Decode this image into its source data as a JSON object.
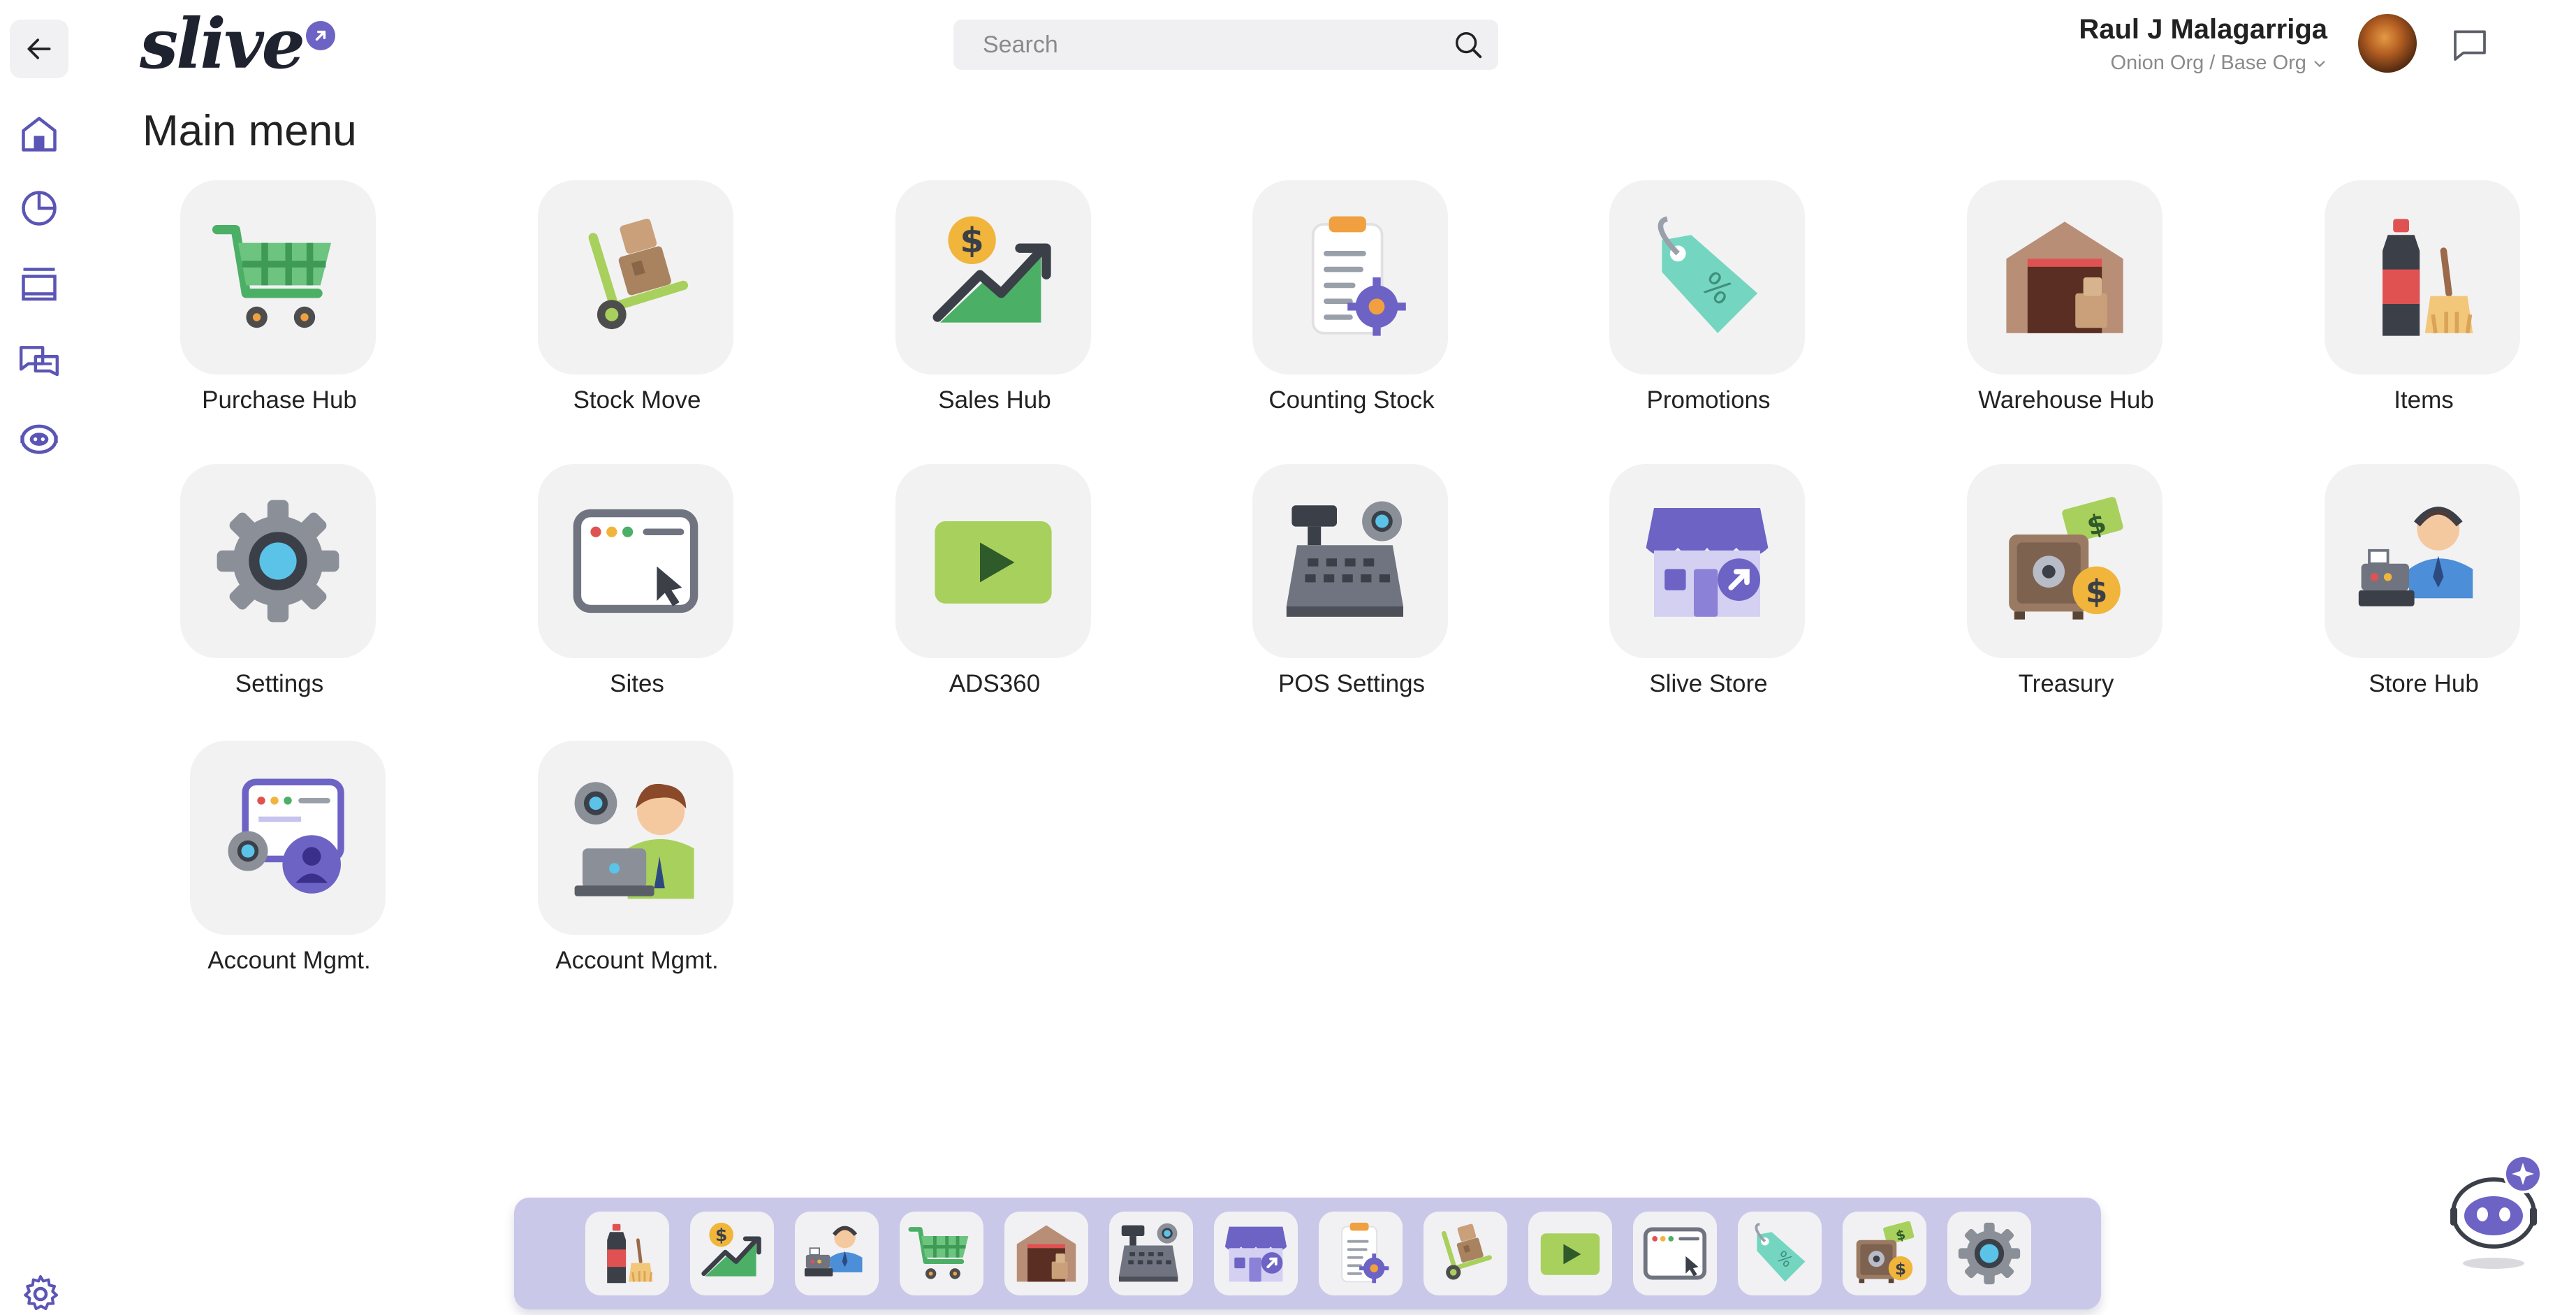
{
  "header": {
    "logo_text": "slive",
    "search_placeholder": "Search",
    "user_name": "Raul J Malagarriga",
    "org_path": "Onion Org /  Base Org"
  },
  "sidebar": {
    "items": [
      {
        "name": "back",
        "icon": "arrow-left-icon"
      },
      {
        "name": "home",
        "icon": "home-icon"
      },
      {
        "name": "analytics",
        "icon": "pie-chart-icon"
      },
      {
        "name": "windows",
        "icon": "window-stack-icon"
      },
      {
        "name": "messages",
        "icon": "chat-bubbles-icon"
      },
      {
        "name": "assistant",
        "icon": "robot-icon"
      }
    ],
    "bottom_icon": "gear-icon"
  },
  "main": {
    "title": "Main menu",
    "tiles": [
      {
        "label": "Purchase Hub",
        "icon": "shopping-cart-icon"
      },
      {
        "label": "Stock Move",
        "icon": "hand-truck-icon"
      },
      {
        "label": "Sales Hub",
        "icon": "sales-growth-icon"
      },
      {
        "label": "Counting Stock",
        "icon": "clipboard-gear-icon"
      },
      {
        "label": "Promotions",
        "icon": "discount-tag-icon"
      },
      {
        "label": "Warehouse Hub",
        "icon": "warehouse-icon"
      },
      {
        "label": "Items",
        "icon": "bottle-broom-icon"
      },
      {
        "label": "Settings",
        "icon": "settings-gear-icon"
      },
      {
        "label": "Sites",
        "icon": "browser-window-icon"
      },
      {
        "label": "ADS360",
        "icon": "play-video-icon"
      },
      {
        "label": "POS Settings",
        "icon": "cash-register-gear-icon"
      },
      {
        "label": "Slive Store",
        "icon": "storefront-icon"
      },
      {
        "label": "Treasury",
        "icon": "safe-money-icon"
      },
      {
        "label": "Store Hub",
        "icon": "store-operator-icon"
      },
      {
        "label": "Account Mgmt.",
        "icon": "account-window-icon"
      },
      {
        "label": "Account Mgmt.",
        "icon": "account-manager-icon"
      }
    ]
  },
  "dock": {
    "items": [
      "bottle-broom-icon",
      "sales-growth-icon",
      "store-operator-icon",
      "shopping-cart-icon",
      "warehouse-icon",
      "cash-register-gear-icon",
      "storefront-icon",
      "clipboard-gear-icon",
      "hand-truck-icon",
      "play-video-icon",
      "browser-window-icon",
      "discount-tag-icon",
      "safe-money-icon",
      "settings-gear-icon"
    ]
  },
  "colors": {
    "accent": "#6d63c5",
    "sidebar_icon": "#5b55b5",
    "tile_bg": "#f2f2f3",
    "dock_bg": "#c9c8e8"
  }
}
